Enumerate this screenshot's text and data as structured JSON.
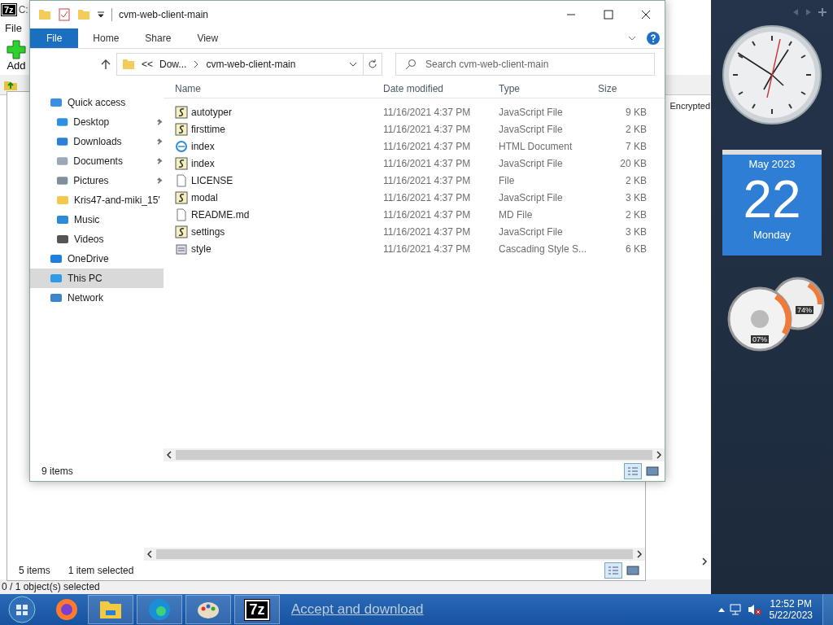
{
  "sevenzip": {
    "icon_text": "7z",
    "title": "C:",
    "menu": [
      "File"
    ],
    "toolbar": [
      {
        "label": "Add",
        "kind": "add"
      }
    ],
    "column": "Encrypted",
    "status": "0 / 1 object(s) selected"
  },
  "back_window": {
    "status_items": "5 items",
    "status_selected": "1 item selected"
  },
  "explorer": {
    "title": "cvm-web-client-main",
    "ribbon_tabs": [
      {
        "label": "File",
        "selected": true
      },
      {
        "label": "Home",
        "selected": false
      },
      {
        "label": "Share",
        "selected": false
      },
      {
        "label": "View",
        "selected": false
      }
    ],
    "address": {
      "overflow": "<<",
      "crumbs": [
        "Dow...",
        "cvm-web-client-main"
      ]
    },
    "search": {
      "placeholder": "Search cvm-web-client-main"
    },
    "nav": [
      {
        "label": "Quick access",
        "kind": "star",
        "selected": false,
        "children": [
          {
            "label": "Desktop",
            "kind": "desktop",
            "pinned": true,
            "selected": false
          },
          {
            "label": "Downloads",
            "kind": "download",
            "pinned": true,
            "selected": false
          },
          {
            "label": "Documents",
            "kind": "document",
            "pinned": true,
            "selected": false
          },
          {
            "label": "Pictures",
            "kind": "picture",
            "pinned": true,
            "selected": false
          },
          {
            "label": "Kris47-and-miki_15'",
            "kind": "folder",
            "pinned": false,
            "selected": false
          },
          {
            "label": "Music",
            "kind": "music",
            "pinned": false,
            "selected": false
          },
          {
            "label": "Videos",
            "kind": "video",
            "pinned": false,
            "selected": false
          }
        ]
      },
      {
        "label": "OneDrive",
        "kind": "cloud",
        "selected": false
      },
      {
        "label": "This PC",
        "kind": "pc",
        "selected": true
      },
      {
        "label": "Network",
        "kind": "network",
        "selected": false
      }
    ],
    "columns": [
      "Name",
      "Date modified",
      "Type",
      "Size"
    ],
    "files": [
      {
        "name": "autotyper",
        "kind": "js",
        "date": "11/16/2021 4:37 PM",
        "type": "JavaScript File",
        "size": "9 KB"
      },
      {
        "name": "firsttime",
        "kind": "js",
        "date": "11/16/2021 4:37 PM",
        "type": "JavaScript File",
        "size": "2 KB"
      },
      {
        "name": "index",
        "kind": "html",
        "date": "11/16/2021 4:37 PM",
        "type": "HTML Document",
        "size": "7 KB"
      },
      {
        "name": "index",
        "kind": "js",
        "date": "11/16/2021 4:37 PM",
        "type": "JavaScript File",
        "size": "20 KB"
      },
      {
        "name": "LICENSE",
        "kind": "file",
        "date": "11/16/2021 4:37 PM",
        "type": "File",
        "size": "2 KB"
      },
      {
        "name": "modal",
        "kind": "js",
        "date": "11/16/2021 4:37 PM",
        "type": "JavaScript File",
        "size": "3 KB"
      },
      {
        "name": "README.md",
        "kind": "file",
        "date": "11/16/2021 4:37 PM",
        "type": "MD File",
        "size": "2 KB"
      },
      {
        "name": "settings",
        "kind": "js",
        "date": "11/16/2021 4:37 PM",
        "type": "JavaScript File",
        "size": "3 KB"
      },
      {
        "name": "style",
        "kind": "css",
        "date": "11/16/2021 4:37 PM",
        "type": "Cascading Style S...",
        "size": "6 KB"
      }
    ],
    "status": "9 items"
  },
  "gadgets": {
    "calendar": {
      "month": "May 2023",
      "day": "22",
      "weekday": "Monday"
    },
    "cpu": "07%",
    "memory": "74%"
  },
  "taskbar": {
    "apps": [
      {
        "kind": "firefox"
      },
      {
        "kind": "explorer"
      },
      {
        "kind": "edge"
      },
      {
        "kind": "paint"
      },
      {
        "kind": "sevenzip",
        "label": "7z"
      }
    ],
    "notice": "Accept and download",
    "time": "12:52 PM",
    "date": "5/22/2023"
  }
}
